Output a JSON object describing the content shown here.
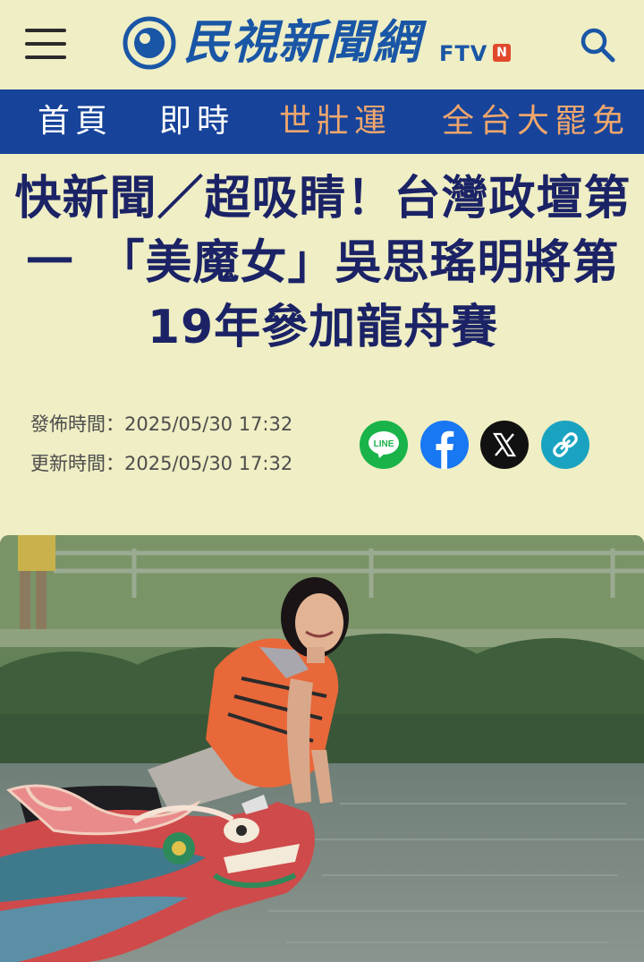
{
  "header": {
    "brand_name": "民視新聞網",
    "brand_badge": "FTV",
    "brand_badge_n": "N",
    "menu_icon": "hamburger-icon",
    "search_icon": "search-icon"
  },
  "nav": {
    "items": [
      {
        "label": "首頁",
        "color": "#ffffff"
      },
      {
        "label": "即時",
        "color": "#ffffff"
      },
      {
        "label": "世壯運",
        "color": "#f0a66c"
      },
      {
        "label": "全台大罷免",
        "color": "#f0a66c"
      }
    ]
  },
  "article": {
    "title": "快新聞／超吸睛！台灣政壇第一　「美魔女」吳思瑤明將第19年參加龍舟賽",
    "published_label": "發佈時間：",
    "published_value": "2025/05/30 17:32",
    "updated_label": "更新時間：",
    "updated_value": "2025/05/30 17:32",
    "share": [
      {
        "icon": "line-icon",
        "label": "LINE",
        "color": "#19b34a"
      },
      {
        "icon": "facebook-icon",
        "color": "#1877f2"
      },
      {
        "icon": "x-icon",
        "color": "#111111"
      },
      {
        "icon": "link-icon",
        "color": "#1aa3c1"
      }
    ],
    "photo_icon": "article-photo"
  },
  "colors": {
    "page_bg": "#efeec4",
    "nav_bg": "#17449a",
    "title": "#1b2366",
    "brand": "#1a56a6"
  }
}
